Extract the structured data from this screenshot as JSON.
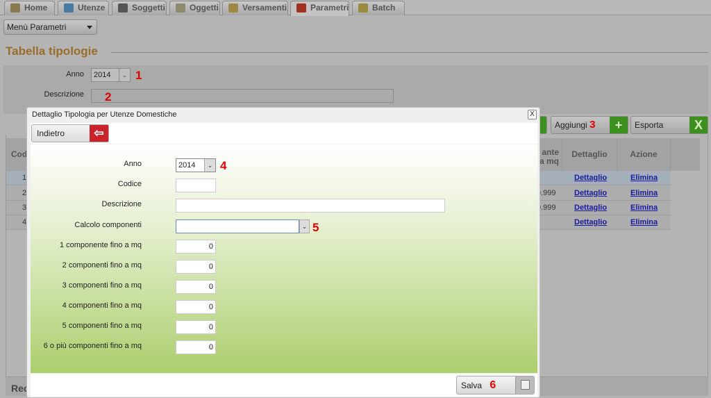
{
  "tabs": [
    {
      "label": "Home",
      "icon": "home-icon",
      "color": "#8a7a50"
    },
    {
      "label": "Utenze",
      "icon": "users-icon",
      "color": "#4a7aa0"
    },
    {
      "label": "Soggetti",
      "icon": "person-icon",
      "color": "#555"
    },
    {
      "label": "Oggetti",
      "icon": "building-icon",
      "color": "#8d8a70"
    },
    {
      "label": "Versamenti",
      "icon": "payments-icon",
      "color": "#a0884a"
    },
    {
      "label": "Parametri",
      "icon": "parameters-icon",
      "color": "#a03020",
      "active": true
    },
    {
      "label": "Batch",
      "icon": "batch-gear-icon",
      "color": "#9a8a40"
    }
  ],
  "menu": {
    "label": "Menù Parametri"
  },
  "page": {
    "title": "Tabella tipologie"
  },
  "filter": {
    "anno_label": "Anno",
    "anno_value": "2014",
    "descrizione_label": "Descrizione",
    "descrizione_value": ""
  },
  "toolbar": {
    "aggiungi": "Aggiungi",
    "esporta": "Esporta"
  },
  "table": {
    "headers": [
      "Cod",
      "ante\na mq",
      "Dettaglio",
      "Azione"
    ],
    "rows": [
      {
        "code": "1",
        "value": "",
        "detail": "Dettaglio",
        "action": "Elimina"
      },
      {
        "code": "2",
        "value": "9.999",
        "detail": "Dettaglio",
        "action": "Elimina"
      },
      {
        "code": "3",
        "value": "9.999",
        "detail": "Dettaglio",
        "action": "Elimina"
      },
      {
        "code": "4",
        "value": "",
        "detail": "Dettaglio",
        "action": "Elimina"
      }
    ],
    "footer": "Rec"
  },
  "annotations": [
    "1",
    "2",
    "3",
    "4",
    "5",
    "6"
  ],
  "dialog": {
    "title": "Dettaglio Tipologia per Utenze Domestiche",
    "close": "X",
    "back": "Indietro",
    "save": "Salva",
    "fields": {
      "anno": {
        "label": "Anno",
        "value": "2014"
      },
      "codice": {
        "label": "Codice",
        "value": ""
      },
      "descrizione": {
        "label": "Descrizione",
        "value": ""
      },
      "calcolo": {
        "label": "Calcolo componenti",
        "value": ""
      },
      "c1": {
        "label": "1 componente fino a mq",
        "value": "0"
      },
      "c2": {
        "label": "2 componenti fino a mq",
        "value": "0"
      },
      "c3": {
        "label": "3 componenti fino a mq",
        "value": "0"
      },
      "c4": {
        "label": "4 componenti fino a mq",
        "value": "0"
      },
      "c5": {
        "label": "5 componenti fino a mq",
        "value": "0"
      },
      "c6": {
        "label": "6 o più componenti fino a mq",
        "value": "0"
      }
    }
  }
}
